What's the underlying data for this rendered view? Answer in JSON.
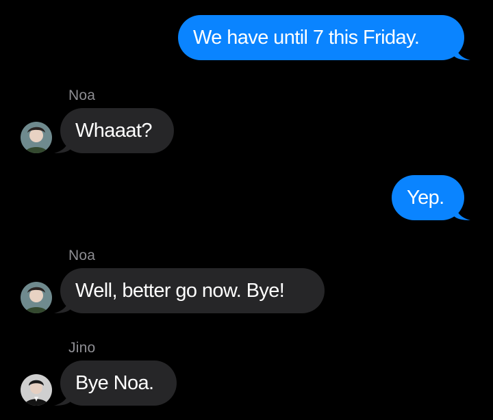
{
  "conversation": {
    "messages": [
      {
        "direction": "outgoing",
        "text": "We have until 7 this Friday."
      },
      {
        "direction": "incoming",
        "sender": "Noa",
        "text": "Whaaat?"
      },
      {
        "direction": "outgoing",
        "text": "Yep."
      },
      {
        "direction": "incoming",
        "sender": "Noa",
        "text": "Well, better go now. Bye!"
      },
      {
        "direction": "incoming",
        "sender": "Jino",
        "text": "Bye Noa."
      }
    ]
  },
  "colors": {
    "background": "#000000",
    "outgoing_bubble": "#0a84ff",
    "incoming_bubble": "#262628",
    "sender_label": "#8e8e93"
  },
  "icons": {
    "noa_avatar": "avatar-photo-icon",
    "jino_avatar": "avatar-photo-icon"
  }
}
